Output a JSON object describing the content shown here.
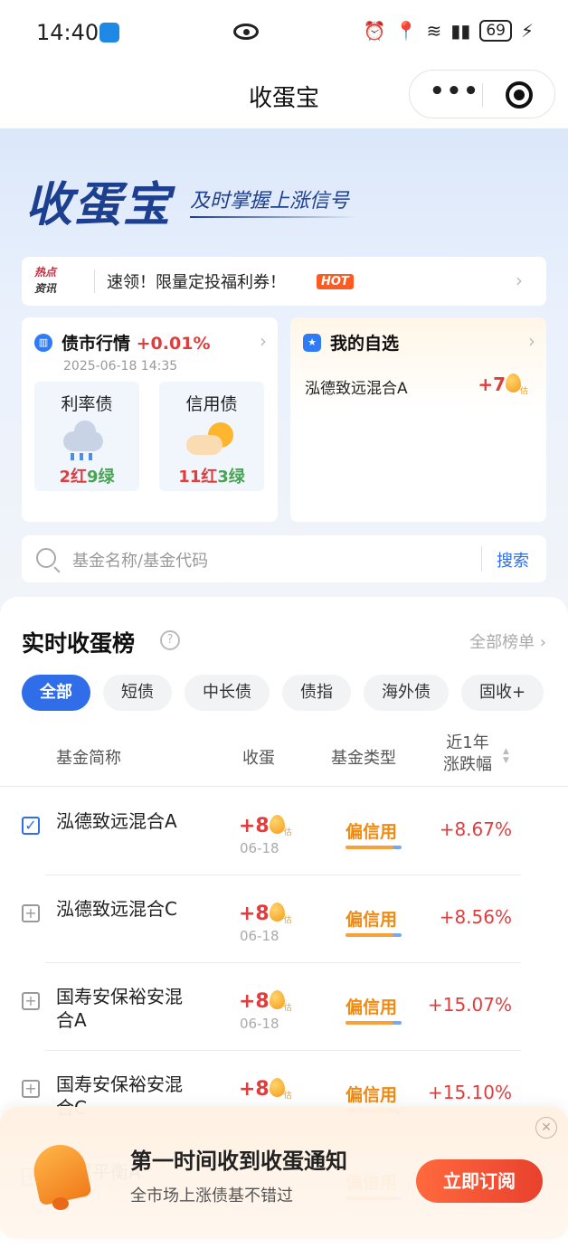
{
  "status_bar": {
    "time": "14:40",
    "battery": "69"
  },
  "header": {
    "title": "收蛋宝",
    "more": "•••"
  },
  "hero": {
    "brand": "收蛋宝",
    "slogan": "及时掌握上涨信号"
  },
  "notice": {
    "tag_line1": "热点",
    "tag_line2": "资讯",
    "text": "速领！限量定投福利券！",
    "badge": "HOT"
  },
  "market": {
    "title": "债市行情",
    "change": "+0.01%",
    "date": "2025-06-18 14:35",
    "cards": [
      {
        "name": "利率债",
        "red": "2红",
        "green": "9绿",
        "weather": "rain"
      },
      {
        "name": "信用债",
        "red": "11红",
        "green": "3绿",
        "weather": "sunny"
      }
    ]
  },
  "favorites": {
    "title": "我的自选",
    "item_name": "泓德致远混合A",
    "item_value": "+7",
    "est": "估"
  },
  "search": {
    "placeholder": "基金名称/基金代码",
    "button": "搜索"
  },
  "ranking": {
    "title": "实时收蛋榜",
    "all_label": "全部榜单",
    "chips": [
      "全部",
      "短债",
      "中长债",
      "债指",
      "海外债",
      "固收+"
    ],
    "active_chip": "全部",
    "columns": {
      "name": "基金简称",
      "egg": "收蛋",
      "type": "基金类型",
      "change_line1": "近1年",
      "change_line2": "涨跌幅"
    },
    "rows": [
      {
        "name": "泓德致远混合A",
        "egg": "+8",
        "date": "06-18",
        "type": "偏信用",
        "change": "+8.67%",
        "checked": true
      },
      {
        "name": "泓德致远混合C",
        "egg": "+8",
        "date": "06-18",
        "type": "偏信用",
        "change": "+8.56%",
        "checked": false
      },
      {
        "name": "国寿安保裕安混合A",
        "egg": "+8",
        "date": "06-18",
        "type": "偏信用",
        "change": "+15.07%",
        "checked": false
      },
      {
        "name": "国寿安保裕安混合C",
        "egg": "+8",
        "date": "",
        "type": "偏信用",
        "change": "+15.10%",
        "checked": false
      },
      {
        "name": "双翼平衡A",
        "egg": "",
        "date": "",
        "type": "偏信用",
        "change": "",
        "checked": false
      }
    ]
  },
  "subscribe": {
    "title": "第一时间收到收蛋通知",
    "desc": "全市场上涨债基不错过",
    "button": "立即订阅",
    "close": "✕"
  },
  "colors": {
    "accent": "#2f6ee8",
    "up": "#e03e3e",
    "down": "#49a355",
    "type": "#f08a12"
  }
}
